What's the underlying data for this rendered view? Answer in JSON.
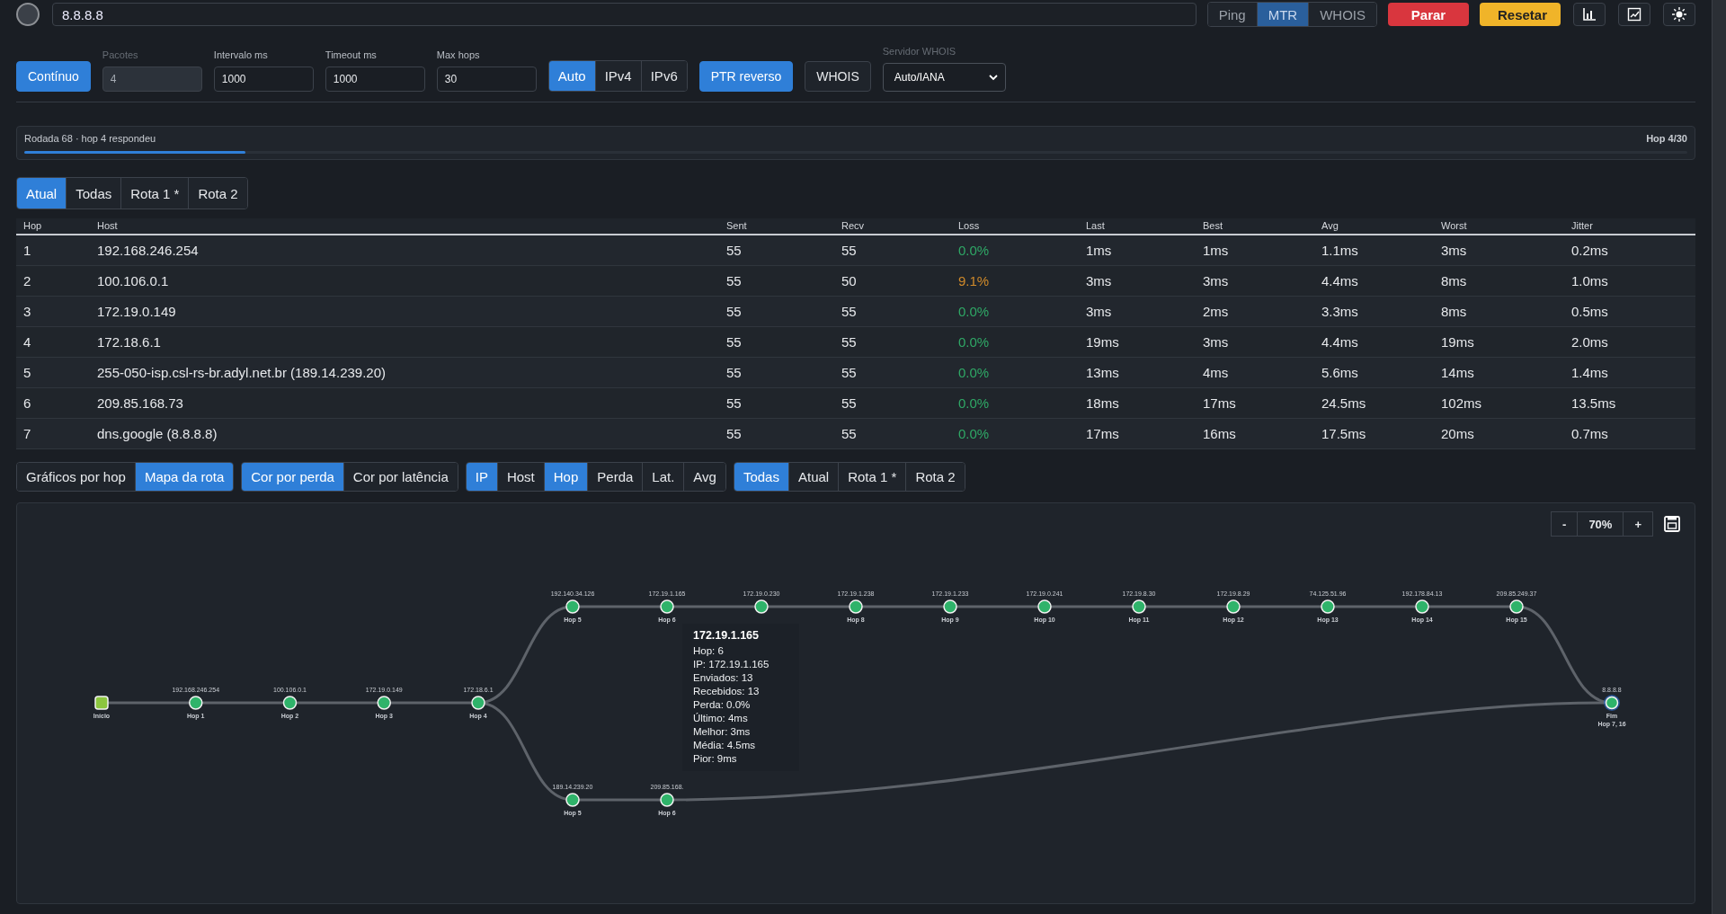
{
  "header": {
    "search": {
      "value": "8.8.8.8"
    },
    "modes": [
      {
        "label": "Ping",
        "selected": false
      },
      {
        "label": "MTR",
        "selected": true
      },
      {
        "label": "WHOIS",
        "selected": false
      }
    ],
    "actions": [
      {
        "label": "Parar",
        "kind": "danger"
      },
      {
        "label": "Resetar",
        "kind": "warning"
      }
    ]
  },
  "controls": {
    "continuous": {
      "label": "Contínuo",
      "on": true
    },
    "fields": [
      {
        "label": "Pacotes",
        "value": "4",
        "disabled": true
      },
      {
        "label": "Intervalo ms",
        "value": "1000",
        "disabled": false
      },
      {
        "label": "Timeout ms",
        "value": "1000",
        "disabled": false
      },
      {
        "label": "Max hops",
        "value": "30",
        "disabled": false
      }
    ],
    "ip_versions": [
      {
        "label": "Auto",
        "selected": true
      },
      {
        "label": "IPv4",
        "selected": false
      },
      {
        "label": "IPv6",
        "selected": false
      }
    ],
    "toggles": [
      {
        "label": "PTR reverso",
        "on": true
      },
      {
        "label": "WHOIS",
        "on": false
      }
    ],
    "whois_server": {
      "label": "Servidor WHOIS",
      "value": "Auto/IANA",
      "disabled": true
    }
  },
  "progress": {
    "text": "Rodada 68 · hop 4 respondeu",
    "level": 0.133,
    "reading": "Hop 4/30"
  },
  "route_tabs": [
    {
      "label": "Atual",
      "selected": true
    },
    {
      "label": "Todas",
      "selected": false
    },
    {
      "label": "Rota 1 *",
      "selected": false
    },
    {
      "label": "Rota 2",
      "selected": false
    }
  ],
  "table": {
    "columns": [
      "Hop",
      "Host",
      "Sent",
      "Recv",
      "Loss",
      "Last",
      "Best",
      "Avg",
      "Worst",
      "Jitter"
    ],
    "rows": [
      {
        "hop": "1",
        "host": "192.168.246.254",
        "sent": "55",
        "recv": "55",
        "loss": {
          "text": "0.0%",
          "color": "#2fa866"
        },
        "last": "1ms",
        "best": "1ms",
        "avg": "1.1ms",
        "worst": "3ms",
        "jitter": "0.2ms"
      },
      {
        "hop": "2",
        "host": "100.106.0.1",
        "sent": "55",
        "recv": "50",
        "loss": {
          "text": "9.1%",
          "color": "#d08a2a"
        },
        "last": "3ms",
        "best": "3ms",
        "avg": "4.4ms",
        "worst": "8ms",
        "jitter": "1.0ms"
      },
      {
        "hop": "3",
        "host": "172.19.0.149",
        "sent": "55",
        "recv": "55",
        "loss": {
          "text": "0.0%",
          "color": "#2fa866"
        },
        "last": "3ms",
        "best": "2ms",
        "avg": "3.3ms",
        "worst": "8ms",
        "jitter": "0.5ms"
      },
      {
        "hop": "4",
        "host": "172.18.6.1",
        "sent": "55",
        "recv": "55",
        "loss": {
          "text": "0.0%",
          "color": "#2fa866"
        },
        "last": "19ms",
        "best": "3ms",
        "avg": "4.4ms",
        "worst": "19ms",
        "jitter": "2.0ms"
      },
      {
        "hop": "5",
        "host": "255-050-isp.csl-rs-br.adyl.net.br (189.14.239.20)",
        "sent": "55",
        "recv": "55",
        "loss": {
          "text": "0.0%",
          "color": "#2fa866"
        },
        "last": "13ms",
        "best": "4ms",
        "avg": "5.6ms",
        "worst": "14ms",
        "jitter": "1.4ms"
      },
      {
        "hop": "6",
        "host": "209.85.168.73",
        "sent": "55",
        "recv": "55",
        "loss": {
          "text": "0.0%",
          "color": "#2fa866"
        },
        "last": "18ms",
        "best": "17ms",
        "avg": "24.5ms",
        "worst": "102ms",
        "jitter": "13.5ms"
      },
      {
        "hop": "7",
        "host": "dns.google (8.8.8.8)",
        "sent": "55",
        "recv": "55",
        "loss": {
          "text": "0.0%",
          "color": "#2fa866"
        },
        "last": "17ms",
        "best": "16ms",
        "avg": "17.5ms",
        "worst": "20ms",
        "jitter": "0.7ms"
      }
    ]
  },
  "view_groups": [
    [
      {
        "label": "Gráficos por hop",
        "selected": false
      },
      {
        "label": "Mapa da rota",
        "selected": true
      }
    ],
    [
      {
        "label": "Cor por perda",
        "selected": true
      },
      {
        "label": "Cor por latência",
        "selected": false
      }
    ],
    [
      {
        "label": "IP",
        "selected": true
      },
      {
        "label": "Host",
        "selected": false
      },
      {
        "label": "Hop",
        "selected": true
      },
      {
        "label": "Perda",
        "selected": false
      },
      {
        "label": "Lat.",
        "selected": false
      },
      {
        "label": "Avg",
        "selected": false
      }
    ],
    [
      {
        "label": "Todas",
        "selected": true
      },
      {
        "label": "Atual",
        "selected": false
      },
      {
        "label": "Rota 1 *",
        "selected": false
      },
      {
        "label": "Rota 2",
        "selected": false
      }
    ]
  ],
  "map": {
    "zoom": {
      "minus": "-",
      "level": "70%",
      "plus": "+"
    },
    "start": {
      "label": "Início"
    },
    "trunk": [
      {
        "ip": "192.168.246.254",
        "label": "Hop 1"
      },
      {
        "ip": "100.106.0.1",
        "label": "Hop 2"
      },
      {
        "ip": "172.19.0.149",
        "label": "Hop 3"
      },
      {
        "ip": "172.18.6.1",
        "label": "Hop 4"
      }
    ],
    "routes": [
      {
        "nodes": [
          {
            "ip": "192.140.34.126",
            "label": "Hop 5"
          },
          {
            "ip": "172.19.1.165",
            "label": "Hop 6"
          },
          {
            "ip": "172.19.0.230"
          },
          {
            "ip": "172.19.1.238",
            "label": "Hop 8"
          },
          {
            "ip": "172.19.1.233",
            "label": "Hop 9"
          },
          {
            "ip": "172.19.0.241",
            "label": "Hop 10"
          },
          {
            "ip": "172.19.8.30",
            "label": "Hop 11"
          },
          {
            "ip": "172.19.8.29",
            "label": "Hop 12"
          },
          {
            "ip": "74.125.51.96",
            "label": "Hop 13"
          },
          {
            "ip": "192.178.84.13",
            "label": "Hop 14"
          },
          {
            "ip": "209.85.249.37",
            "label": "Hop 15"
          }
        ]
      },
      {
        "nodes": [
          {
            "ip": "189.14.239.20",
            "label": "Hop 5"
          },
          {
            "ip": "209.85.168.",
            "label": "Hop 6"
          }
        ]
      }
    ],
    "end": {
      "ip": "8.8.8.8",
      "label": "Fim",
      "sublabel": "Hop 7, 16"
    },
    "tooltip": {
      "title": "172.19.1.165",
      "lines": [
        "Hop: 6",
        "IP: 172.19.1.165",
        "Enviados: 13",
        "Recebidos: 13",
        "Perda: 0.0%",
        "Último: 4ms",
        "Melhor: 3ms",
        "Média: 4.5ms",
        "Pior: 9ms"
      ]
    }
  }
}
